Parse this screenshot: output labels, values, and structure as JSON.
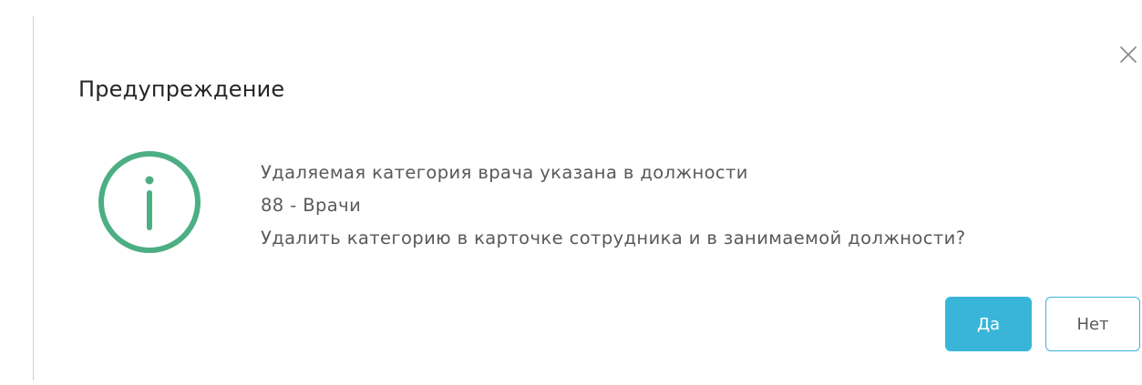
{
  "dialog": {
    "title": "Предупреждение",
    "message_lines": [
      "Удаляемая категория врача указана в должности",
      "88 - Врачи",
      "Удалить категорию в карточке сотрудника и в занимаемой должности?"
    ],
    "icon": "info-circle-icon",
    "close_icon": "close-icon",
    "buttons": {
      "yes_label": "Да",
      "no_label": "Нет"
    }
  },
  "colors": {
    "info_icon": "#4caf84",
    "primary_button": "#39b5d9",
    "title_text": "#262626",
    "body_text": "#595959"
  }
}
